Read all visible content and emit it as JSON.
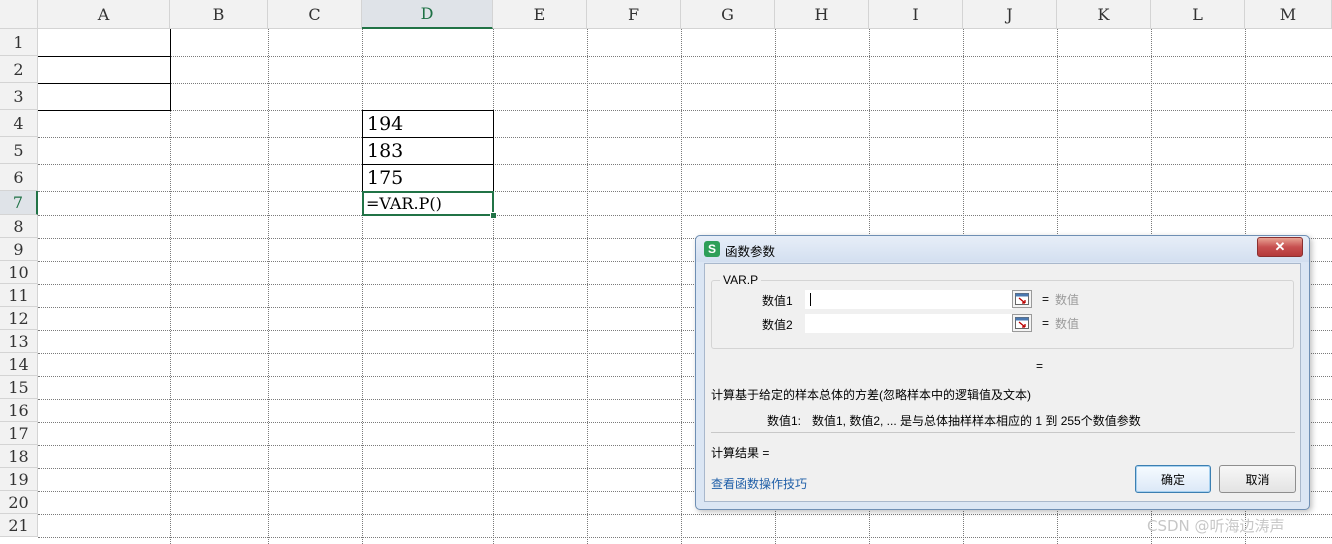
{
  "sheet": {
    "columns": [
      "A",
      "B",
      "C",
      "D",
      "E",
      "F",
      "G",
      "H",
      "I",
      "J",
      "K",
      "L",
      "M"
    ],
    "rows": [
      "1",
      "2",
      "3",
      "4",
      "5",
      "6",
      "7",
      "8",
      "9",
      "10",
      "11",
      "12",
      "13",
      "14",
      "15",
      "16",
      "17",
      "18",
      "19",
      "20",
      "21"
    ],
    "selected_column": "D",
    "selected_row": "7",
    "cells": {
      "D4": "194",
      "D5": "183",
      "D6": "175",
      "D7": "=VAR.P()"
    }
  },
  "dialog": {
    "app_icon": "S",
    "title": "函数参数",
    "close_symbol": "✕",
    "function_name": "VAR.P",
    "arguments": [
      {
        "label": "数值1",
        "equals": "=",
        "hint": "数值"
      },
      {
        "label": "数值2",
        "equals": "=",
        "hint": "数值"
      }
    ],
    "result_equals": "=",
    "description": "计算基于给定的样本总体的方差(忽略样本中的逻辑值及文本)",
    "arg_description_label": "数值1:",
    "arg_description_text": "数值1, 数值2, ... 是与总体抽样样本相应的 1 到 255个数值参数",
    "calc_result_label": "计算结果 =",
    "help_link": "查看函数操作技巧",
    "ok_label": "确定",
    "cancel_label": "取消"
  },
  "watermark": "CSDN @听海边涛声",
  "colors": {
    "selection": "#217346",
    "link": "#1f5fa8",
    "dialog_frame": "#dbe6f4",
    "close_button": "#c75050"
  }
}
